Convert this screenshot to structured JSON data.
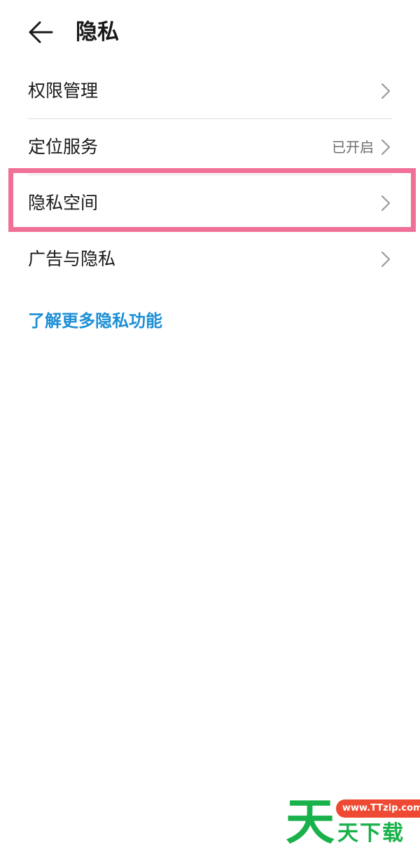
{
  "header": {
    "title": "隐私",
    "back_icon": "arrow-left-icon"
  },
  "list": {
    "items": [
      {
        "label": "权限管理",
        "value": "",
        "icon": "chevron-right-icon"
      },
      {
        "label": "定位服务",
        "value": "已开启",
        "icon": "chevron-right-icon"
      },
      {
        "label": "隐私空间",
        "value": "",
        "icon": "chevron-right-icon",
        "highlighted": true
      },
      {
        "label": "广告与隐私",
        "value": "",
        "icon": "chevron-right-icon"
      }
    ]
  },
  "learn_more": {
    "label": "了解更多隐私功能",
    "color": "#1c8fd6"
  },
  "highlight": {
    "color": "#f07098"
  },
  "watermark": {
    "big_char": "天",
    "url": "www.TTzip.com",
    "text": "天下载",
    "green": "#18b14a",
    "red": "#ee4a33"
  }
}
